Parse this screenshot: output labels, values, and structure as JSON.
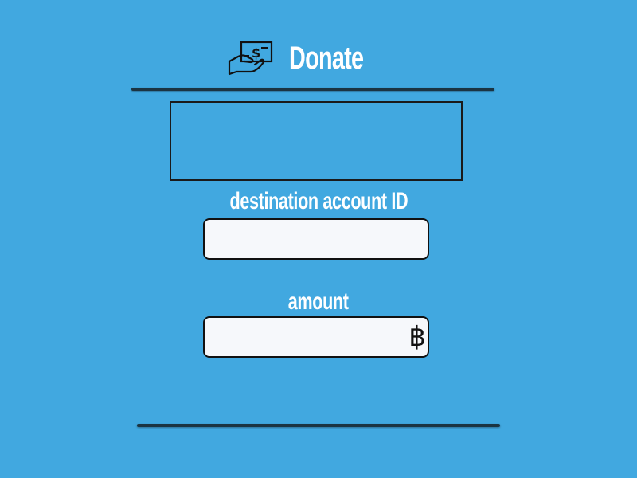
{
  "header": {
    "icon": "donate-money-hand-icon",
    "title": "Donate"
  },
  "display": {
    "text": ""
  },
  "fields": {
    "destination": {
      "label": "destination account ID",
      "value": "",
      "placeholder": ""
    },
    "amount": {
      "label": "amount",
      "value": "",
      "placeholder": "",
      "currency_symbol": "฿",
      "currency_icon": "baht-currency-icon"
    }
  },
  "colors": {
    "background": "#41a8e0",
    "text": "#ffffff",
    "divider": "#1b3442",
    "input_background": "#f6f8fb",
    "border": "#111111"
  }
}
